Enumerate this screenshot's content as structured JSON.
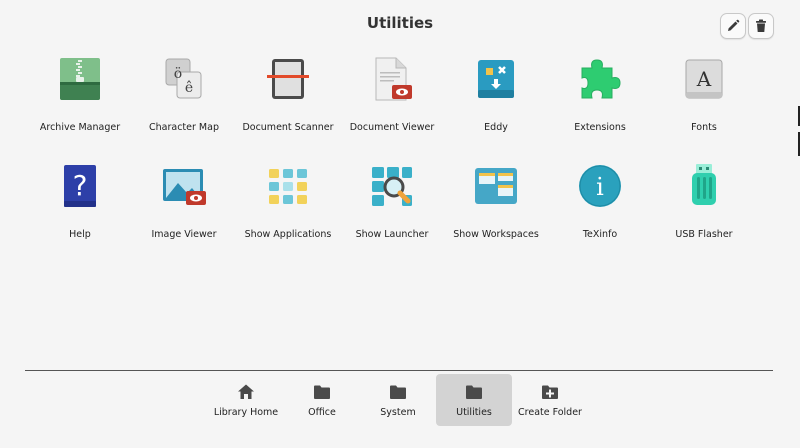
{
  "header": {
    "title": "Utilities",
    "edit_icon": "pencil-icon",
    "delete_icon": "trash-icon"
  },
  "apps": [
    [
      {
        "label": "Archive Manager",
        "icon": "archive-icon"
      },
      {
        "label": "Character Map",
        "icon": "character-map-icon",
        "glyphs": [
          "ö",
          "ê"
        ]
      },
      {
        "label": "Document Scanner",
        "icon": "scanner-icon"
      },
      {
        "label": "Document Viewer",
        "icon": "document-viewer-icon"
      },
      {
        "label": "Eddy",
        "icon": "package-installer-icon"
      },
      {
        "label": "Extensions",
        "icon": "puzzle-icon"
      },
      {
        "label": "Fonts",
        "icon": "fonts-icon",
        "glyph": "A"
      }
    ],
    [
      {
        "label": "Help",
        "icon": "help-icon",
        "glyph": "?"
      },
      {
        "label": "Image Viewer",
        "icon": "image-viewer-icon"
      },
      {
        "label": "Show Applications",
        "icon": "app-grid-icon"
      },
      {
        "label": "Show Launcher",
        "icon": "launcher-search-icon"
      },
      {
        "label": "Show Workspaces",
        "icon": "workspaces-icon"
      },
      {
        "label": "TeXinfo",
        "icon": "info-icon",
        "glyph": "i"
      },
      {
        "label": "USB Flasher",
        "icon": "usb-drive-icon"
      }
    ]
  ],
  "tabs": [
    {
      "label": "Library Home",
      "icon": "home-icon",
      "active": false
    },
    {
      "label": "Office",
      "icon": "folder-icon",
      "active": false
    },
    {
      "label": "System",
      "icon": "folder-icon",
      "active": false
    },
    {
      "label": "Utilities",
      "icon": "folder-icon",
      "active": true
    },
    {
      "label": "Create Folder",
      "icon": "new-folder-icon",
      "active": false
    }
  ],
  "colors": {
    "background": "#f5f5f5",
    "active_tab": "#d3d3d3",
    "icon_dark": "#4a4a4a",
    "divider": "#555555"
  }
}
